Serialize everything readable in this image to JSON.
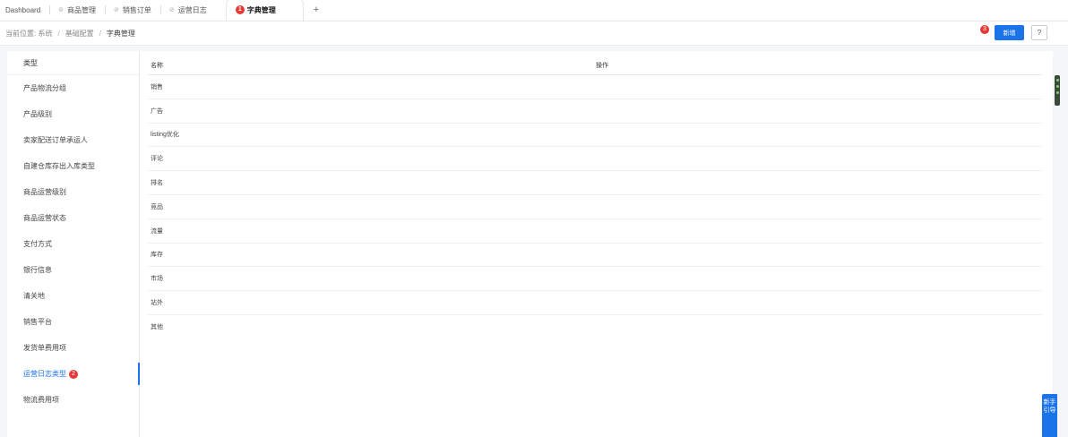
{
  "tabs": [
    {
      "label": "Dashboard",
      "pinned": false,
      "active": false
    },
    {
      "label": "商品管理",
      "pinned": true,
      "active": false
    },
    {
      "label": "销售订单",
      "pinned": true,
      "active": false
    },
    {
      "label": "运营日志",
      "pinned": true,
      "active": false
    },
    {
      "label": "字典管理",
      "pinned": false,
      "active": true,
      "badge": "1"
    }
  ],
  "tab_add_label": "+",
  "breadcrumb": {
    "prefix": "当前位置: 系统",
    "mid": "基础配置",
    "current": "字典管理",
    "sep": "/"
  },
  "toolbar": {
    "badge": "3",
    "new_label": "新增",
    "help_label": "?"
  },
  "sidebar": {
    "header": "类型",
    "items": [
      {
        "label": "产品物流分组"
      },
      {
        "label": "产品级别"
      },
      {
        "label": "卖家配送订单承运人"
      },
      {
        "label": "自建仓库存出入库类型"
      },
      {
        "label": "商品运营级别"
      },
      {
        "label": "商品运营状态"
      },
      {
        "label": "支付方式"
      },
      {
        "label": "银行信息"
      },
      {
        "label": "清关地"
      },
      {
        "label": "销售平台"
      },
      {
        "label": "发货单费用项"
      },
      {
        "label": "运营日志类型",
        "selected": true,
        "badge": "2"
      },
      {
        "label": "物流费用项"
      }
    ]
  },
  "table": {
    "columns": [
      "名称",
      "操作"
    ],
    "rows": [
      "销售",
      "广告",
      "listing优化",
      "评论",
      "排名",
      "竞品",
      "流量",
      "库存",
      "市场",
      "站外",
      "其他"
    ]
  },
  "guide_label": "新手引导",
  "colors": {
    "accent": "#1a73e8",
    "badge": "#e53935"
  }
}
